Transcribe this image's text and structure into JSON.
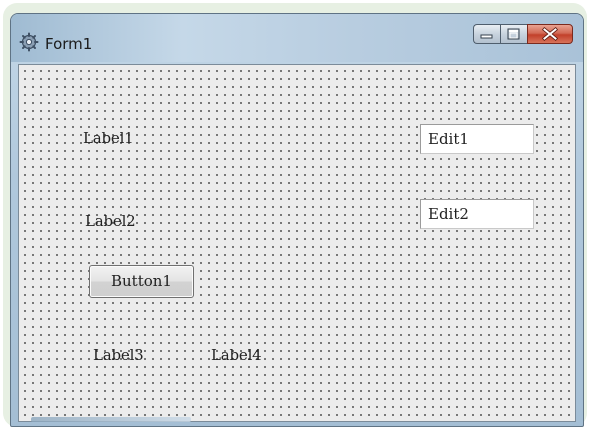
{
  "window": {
    "title": "Form1",
    "controls": {
      "minimize_icon": "minimize-icon",
      "maximize_icon": "maximize-icon",
      "close_icon": "close-icon"
    }
  },
  "form": {
    "labels": {
      "label1": "Label1",
      "label2": "Label2",
      "label3": "Label3",
      "label4": "Label4"
    },
    "edits": {
      "edit1": "Edit1",
      "edit2": "Edit2"
    },
    "button1": "Button1"
  },
  "colors": {
    "close_button": "#c9503a",
    "title_bar": "#b8cde0",
    "form_background": "#ececec"
  }
}
